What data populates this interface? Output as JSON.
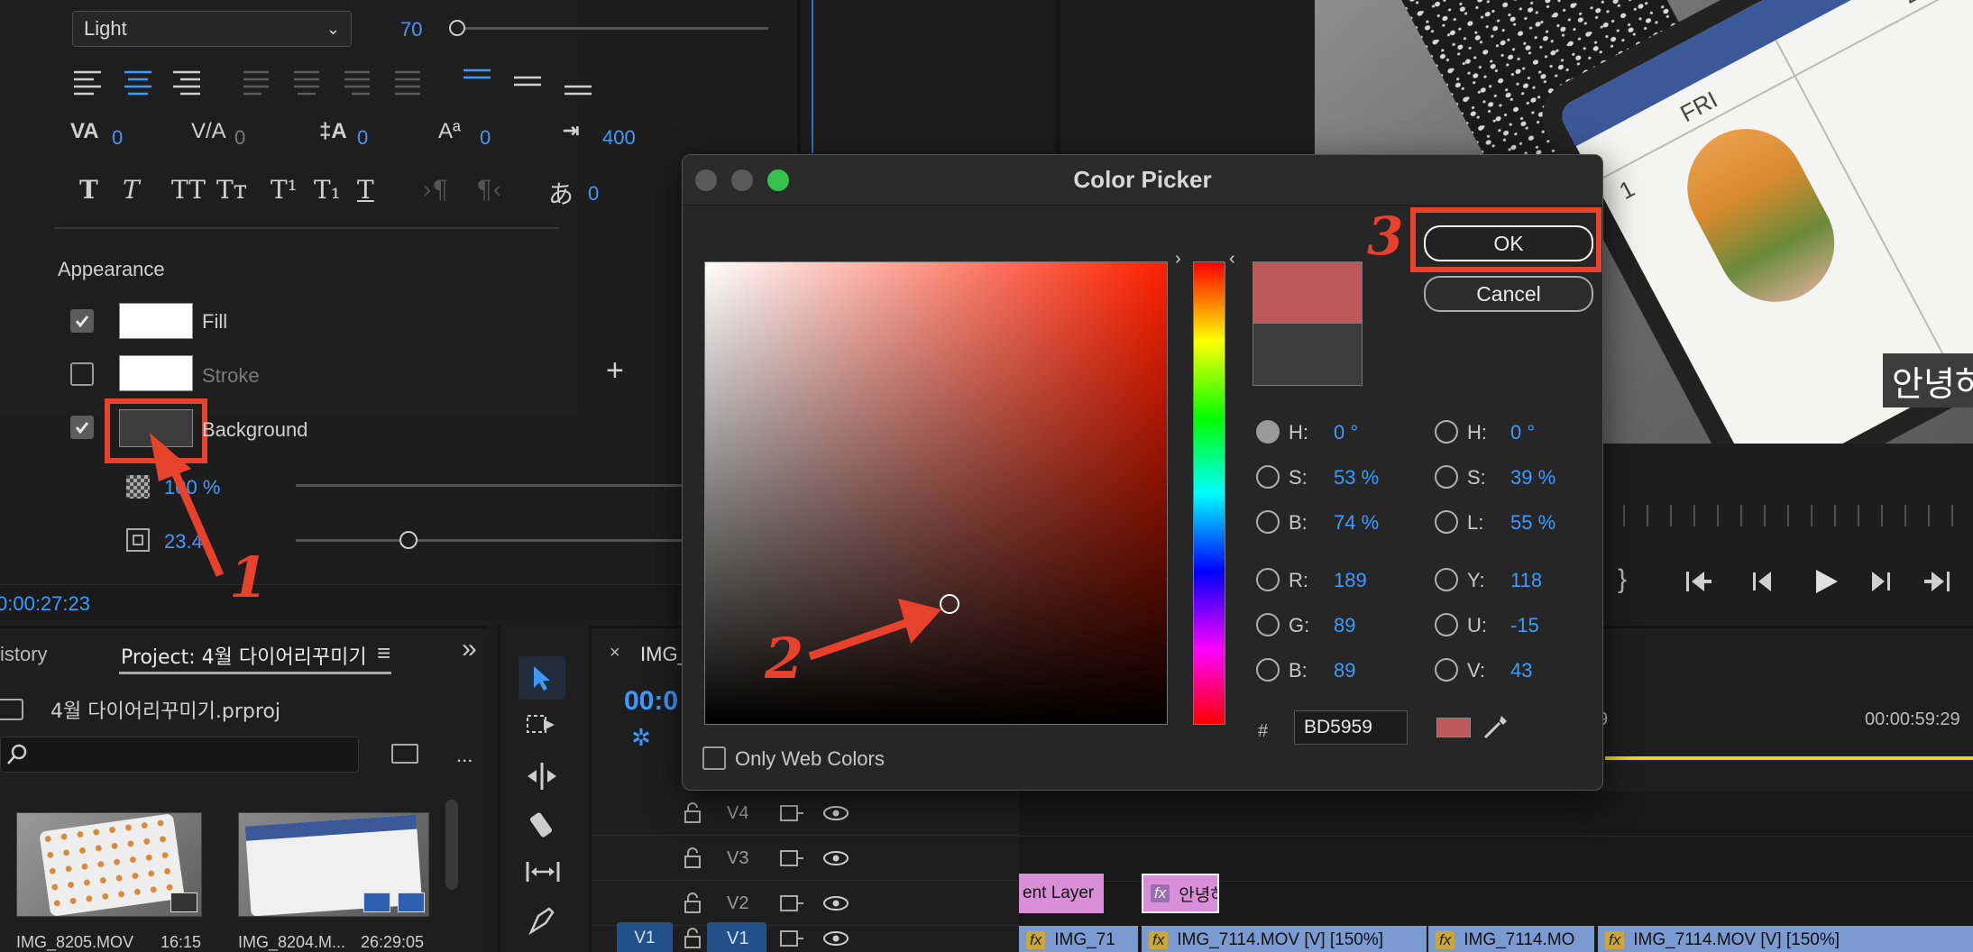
{
  "text_panel": {
    "font_style": "Light",
    "font_size": "70",
    "tracking": "0",
    "kerning": "0",
    "leading": "0",
    "baseline": "0",
    "tab_width": "400",
    "tsume": "0"
  },
  "appearance": {
    "heading": "Appearance",
    "fill_label": "Fill",
    "stroke_label": "Stroke",
    "background_label": "Background",
    "opacity": "100 %",
    "size": "23.4"
  },
  "timecode": "0:00:27:23",
  "project_panel": {
    "history_tab": "istory",
    "project_tab": "Project: 4월 다이어리꾸미기",
    "project_file": "4월 다이어리꾸미기.prproj",
    "clips": [
      {
        "name": "IMG_8205.MOV",
        "duration": "16:15"
      },
      {
        "name": "IMG_8204.M...",
        "duration": "26:29:05"
      }
    ]
  },
  "timeline": {
    "sequence_tab": "IMG_",
    "timecode": "00:0",
    "end_timecode": "00:00:59:29",
    "ruler_label": "9",
    "tracks": [
      "V4",
      "V3",
      "V2",
      "V1"
    ],
    "v1_source": "V1",
    "clips_v2": [
      "ent Layer",
      "안녕하"
    ],
    "clips_v1": [
      "IMG_71",
      "IMG_7114.MOV [V] [150%]",
      "IMG_7114.MO",
      "IMG_7114.MOV [V] [150%]"
    ],
    "fx_label": "fx"
  },
  "preview": {
    "subtitle": "안녕하세요 반갑습니",
    "calendar_day": "FRI",
    "calendar_num_1": "1",
    "calendar_num_2": "2",
    "bracket": "}"
  },
  "color_picker": {
    "title": "Color Picker",
    "ok": "OK",
    "cancel": "Cancel",
    "hsb": {
      "h_label": "H:",
      "h": "0 °",
      "s_label": "S:",
      "s": "53 %",
      "b_label": "B:",
      "b": "74 %"
    },
    "rgb": {
      "r_label": "R:",
      "r": "189",
      "g_label": "G:",
      "g": "89",
      "b_label": "B:",
      "b": "89"
    },
    "hsl": {
      "h_label": "H:",
      "h": "0 °",
      "s_label": "S:",
      "s": "39 %",
      "l_label": "L:",
      "l": "55 %"
    },
    "yuv": {
      "y_label": "Y:",
      "y": "118",
      "u_label": "U:",
      "u": "-15",
      "v_label": "V:",
      "v": "43"
    },
    "hash": "#",
    "hex": "BD5959",
    "only_web_colors": "Only Web Colors",
    "new_color": "#bd5959",
    "old_color": "#3c3c3c"
  },
  "annotations": {
    "step1": "1",
    "step2": "2",
    "step3": "3",
    "color": "#e8412c"
  }
}
